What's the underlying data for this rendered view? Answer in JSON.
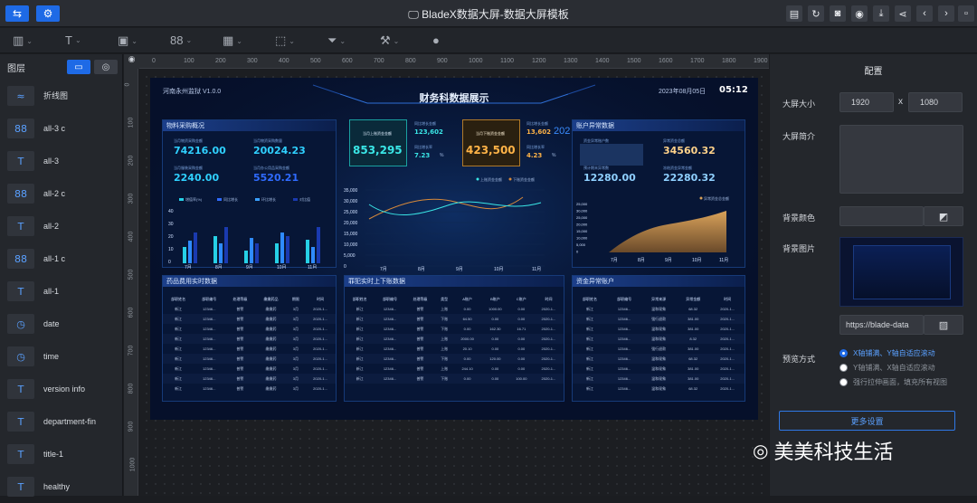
{
  "app": {
    "title": "BladeX数据大屏-数据大屏模板",
    "title_icon": "monitor-icon"
  },
  "toolbar_left": [
    {
      "icon": "settings-sliders-icon"
    },
    {
      "icon": "gear-icon"
    }
  ],
  "toolbar_right": [
    {
      "icon": "document-icon"
    },
    {
      "icon": "refresh-icon"
    },
    {
      "icon": "camera-icon"
    },
    {
      "icon": "eye-icon"
    },
    {
      "icon": "download-icon"
    },
    {
      "icon": "share-icon"
    },
    {
      "icon": "arrow-left-icon"
    },
    {
      "icon": "arrow-right-icon"
    }
  ],
  "tools": [
    {
      "glyph": "▥",
      "name": "chart"
    },
    {
      "glyph": "T",
      "name": "text"
    },
    {
      "glyph": "▣",
      "name": "image"
    },
    {
      "glyph": "88",
      "name": "counter"
    },
    {
      "glyph": "▦",
      "name": "table"
    },
    {
      "glyph": "⬚",
      "name": "border"
    },
    {
      "glyph": "⏷",
      "name": "filter"
    },
    {
      "glyph": "⚒",
      "name": "tools"
    },
    {
      "glyph": "●",
      "name": "info"
    }
  ],
  "layers": {
    "title": "图层",
    "items": [
      {
        "icon": "≈",
        "name": "line-chart-icon",
        "label": "折线图"
      },
      {
        "icon": "88",
        "name": "counter-icon",
        "label": "all-3 c"
      },
      {
        "icon": "T",
        "name": "text-icon",
        "label": "all-3"
      },
      {
        "icon": "88",
        "name": "counter-icon",
        "label": "all-2 c"
      },
      {
        "icon": "T",
        "name": "text-icon",
        "label": "all-2"
      },
      {
        "icon": "88",
        "name": "counter-icon",
        "label": "all-1 c"
      },
      {
        "icon": "T",
        "name": "text-icon",
        "label": "all-1"
      },
      {
        "icon": "◷",
        "name": "clock-icon",
        "label": "date"
      },
      {
        "icon": "◷",
        "name": "clock-icon",
        "label": "time"
      },
      {
        "icon": "T",
        "name": "text-icon",
        "label": "version info"
      },
      {
        "icon": "T",
        "name": "text-icon",
        "label": "department-fin"
      },
      {
        "icon": "T",
        "name": "text-icon",
        "label": "title-1"
      },
      {
        "icon": "T",
        "name": "text-icon",
        "label": "healthy"
      }
    ]
  },
  "ruler_ticks": [
    "0",
    "100",
    "200",
    "300",
    "400",
    "500",
    "600",
    "700",
    "800",
    "900",
    "1000",
    "1100",
    "1200",
    "1300",
    "1400",
    "1500",
    "1600",
    "1700",
    "1800",
    "1900"
  ],
  "screen": {
    "title": "财务科数据展示",
    "version": "河南永州监狱 V1.0.0",
    "date": "2023年08月05日",
    "time": "05:12",
    "overview": {
      "title": "物料采购概况",
      "items": [
        {
          "label": "当月物资采购金额",
          "value": "74216.00",
          "color": "#2fd0ff"
        },
        {
          "label": "当月物资采购数量",
          "value": "20024.23",
          "color": "#2fd0ff"
        },
        {
          "label": "当月服装采购金额",
          "value": "2240.00",
          "color": "#2fd0ff"
        },
        {
          "label": "当月办公用品采购金额",
          "value": "5520.21",
          "color": "#2f6bff"
        }
      ]
    },
    "kpi1": {
      "label": "当月上账资金金额",
      "value": "853,295",
      "sub1_label": "同比增长金额",
      "sub1": "123,602",
      "sub2_label": "同比增长率",
      "sub2": "7.23",
      "unit": "%"
    },
    "kpi2": {
      "label": "当月下账资金金额",
      "value": "423,500",
      "sub1_label": "同比增长金额",
      "sub1": "13,602",
      "sub2_label": "同比增长率",
      "sub2": "4.23",
      "unit": "%"
    },
    "overflow": "202",
    "account": {
      "title": "账户异常数据",
      "items": [
        {
          "label": "资金异常账户数",
          "value": "",
          "color": "#ffd28a"
        },
        {
          "label": "异常资金总额",
          "value": "34560.32",
          "color": "#ffd28a"
        },
        {
          "label": "预计期末异常数",
          "value": "12280.00",
          "color": "#8fd0ff"
        },
        {
          "label": "冻结资金异常金额",
          "value": "22280.32",
          "color": "#8fd0ff"
        }
      ]
    },
    "bar_legend": [
      "增值率(%)",
      "同比增长",
      "环比增长",
      "对比值"
    ],
    "bar_yaxis": [
      "40",
      "30",
      "20",
      "10",
      "0"
    ],
    "months": [
      "7月",
      "8月",
      "9月",
      "10月",
      "11月"
    ],
    "line_yaxis": [
      "35,000",
      "30,000",
      "25,000",
      "20,000",
      "15,000",
      "10,000",
      "5,000",
      "0"
    ],
    "line_legend": [
      "上账资金金额",
      "下账资金金额"
    ],
    "area_yaxis": [
      "25,000",
      "30,000",
      "25,000",
      "20,000",
      "15,000",
      "10,000",
      "5,000",
      "0"
    ],
    "area_legend": [
      "异常资金总金额"
    ],
    "table1": {
      "title": "药品费用实时数据",
      "headers": [
        "部职姓名",
        "部职编号",
        "处理等级",
        "缴缴药品",
        "期限",
        "时间"
      ],
      "rows": [
        [
          "新江",
          "12346...",
          "普警",
          "缴缴药",
          "3月",
          "2020-1..."
        ],
        [
          "新江",
          "12346...",
          "普警",
          "缴缴药",
          "3月",
          "2020-1..."
        ],
        [
          "新江",
          "12346...",
          "普警",
          "缴缴药",
          "3月",
          "2020-1..."
        ],
        [
          "新江",
          "12346...",
          "普警",
          "缴缴药",
          "3月",
          "2020-1..."
        ],
        [
          "新江",
          "12346...",
          "普警",
          "缴缴药",
          "3月",
          "2020-1..."
        ],
        [
          "新江",
          "12346...",
          "普警",
          "缴缴药",
          "3月",
          "2020-1..."
        ],
        [
          "新江",
          "12346...",
          "普警",
          "缴缴药",
          "3月",
          "2020-1..."
        ],
        [
          "新江",
          "12346...",
          "普警",
          "缴缴药",
          "3月",
          "2020-1..."
        ],
        [
          "新江",
          "12346...",
          "普警",
          "缴缴药",
          "3月",
          "2020-1..."
        ]
      ]
    },
    "table2": {
      "title": "罪犯实时上下账数据",
      "headers": [
        "部职姓名",
        "部职编号",
        "处理等级",
        "类型",
        "A账户",
        "B账户",
        "C账户",
        "时间"
      ],
      "rows": [
        [
          "新江",
          "12346...",
          "普警",
          "上账",
          "0.00",
          "1000.00",
          "0.00",
          "2020-1..."
        ],
        [
          "新江",
          "12346...",
          "普警",
          "下账",
          "64.50",
          "0.00",
          "0.00",
          "2020-1..."
        ],
        [
          "新江",
          "12346...",
          "普警",
          "下账",
          "0.00",
          "162.30",
          "16.71",
          "2020-1..."
        ],
        [
          "新江",
          "12346...",
          "普警",
          "上账",
          "2000.00",
          "0.00",
          "0.00",
          "2020-1..."
        ],
        [
          "新江",
          "12346...",
          "普警",
          "上账",
          "20.10",
          "0.00",
          "0.00",
          "2020-1..."
        ],
        [
          "新江",
          "12346...",
          "普警",
          "下账",
          "0.00",
          "120.00",
          "0.00",
          "2020-1..."
        ],
        [
          "新江",
          "12346...",
          "普警",
          "上账",
          "244.10",
          "0.00",
          "0.00",
          "2020-1..."
        ],
        [
          "新江",
          "12346...",
          "普警",
          "下账",
          "0.00",
          "0.00",
          "100.00",
          "2020-1..."
        ]
      ]
    },
    "table3": {
      "title": "资金异常账户",
      "headers": [
        "部职姓名",
        "部职编号",
        "异常来源",
        "异常金额",
        "时间"
      ],
      "rows": [
        [
          "新江",
          "12346...",
          "温和现象",
          "68.32",
          "2020-1..."
        ],
        [
          "新江",
          "12346...",
          "强行退款",
          "381.00",
          "2020-1..."
        ],
        [
          "新江",
          "12346...",
          "温和现象",
          "381.00",
          "2020-1..."
        ],
        [
          "新江",
          "12346...",
          "温和现象",
          "8.32",
          "2020-1..."
        ],
        [
          "新江",
          "12346...",
          "强行退款",
          "381.00",
          "2020-1..."
        ],
        [
          "新江",
          "12346...",
          "温和现象",
          "68.32",
          "2020-1..."
        ],
        [
          "新江",
          "12346...",
          "温和现象",
          "381.00",
          "2020-1..."
        ],
        [
          "新江",
          "12346...",
          "温和现象",
          "381.00",
          "2020-1..."
        ],
        [
          "新江",
          "12346...",
          "温和现象",
          "68.32",
          "2020-1..."
        ]
      ]
    }
  },
  "config": {
    "title": "配置",
    "size_label": "大屏大小",
    "width": "1920",
    "height": "1080",
    "times": "x",
    "desc_label": "大屏简介",
    "bgcolor_label": "背景颜色",
    "bgimg_label": "背景图片",
    "bgimg_url": "https://blade-data",
    "mode_label": "预览方式",
    "modes": [
      "X轴铺满、Y轴自适应滚动",
      "Y轴铺满、X轴自适应滚动",
      "强行拉伸画面，填充所有视图"
    ],
    "more_button": "更多设置"
  },
  "watermark": "美美科技生活"
}
